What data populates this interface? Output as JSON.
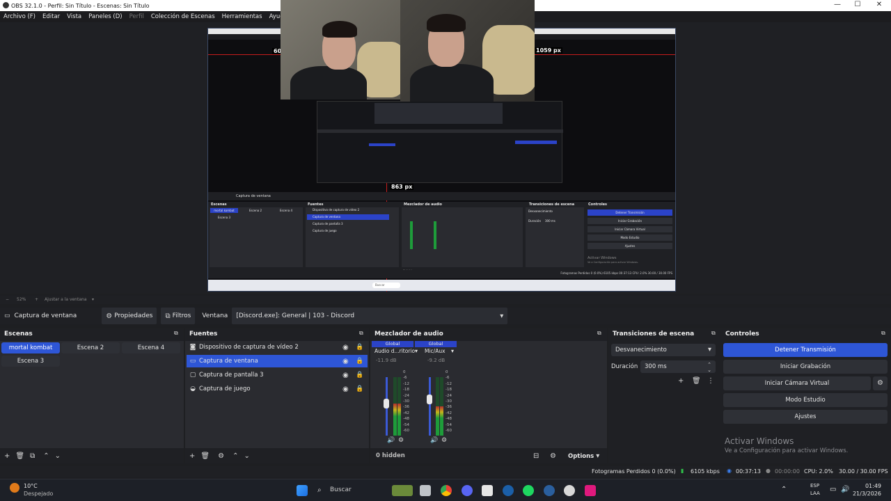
{
  "window": {
    "title": "OBS 32.1.0 - Perfil: Sin Título - Escenas: Sin Título",
    "minimize": "—",
    "maximize": "☐",
    "close": "✕"
  },
  "menu": [
    "Archivo (F)",
    "Editar",
    "Vista",
    "Paneles (D)",
    "Perfil",
    "Colección de Escenas",
    "Herramientas",
    "Ayuda (H)"
  ],
  "preview": {
    "label_right": "1059 px",
    "label_left": "605",
    "label_bottom": "863 px",
    "zoom": "52%",
    "fit": "Ajustar a la ventana",
    "nested": {
      "scenes_title": "Escenas",
      "sources_title": "Fuentes",
      "mixer_title": "Mezclador de audio",
      "transitions_title": "Transiciones de escena",
      "controls_title": "Controles",
      "source_item_1": "Dispositivo de captura de vídeo 2",
      "source_item_2": "Captura de ventana",
      "source_item_3": "Captura de pantalla 3",
      "source_item_4": "Captura de juego",
      "scene_1": "mortal kombat",
      "scene_2": "Escena 2",
      "scene_3": "Escena 4",
      "scene_4": "Escena 3",
      "transition": "Desvanecimiento",
      "duration_label": "Duración",
      "duration": "300 ms",
      "btn_stop": "Detener Transmisión",
      "btn_record": "Iniciar Grabación",
      "btn_vcam": "Iniciar Cámara Virtual",
      "btn_studio": "Modo Estudio",
      "btn_settings": "Ajustes",
      "activate": "Activar Windows",
      "activate_sub": "Ve a Configuración para activar Windows.",
      "search": "Buscar",
      "status": "Fotogramas Perdidos 0 (0.0%)  6105 kbps  00:37:13  CPU: 2.0%  30.00 / 30.00 FPS"
    }
  },
  "toolbar": {
    "source_name": "Captura de ventana",
    "properties": "Propiedades",
    "filters": "Filtros",
    "window_label": "Ventana",
    "window_value": "[Discord.exe]: General | 103 - Discord"
  },
  "scenes": {
    "title": "Escenas",
    "items": [
      "mortal kombat",
      "Escena 2",
      "Escena 4",
      "Escena 3"
    ]
  },
  "sources": {
    "title": "Fuentes",
    "items": [
      {
        "label": "Dispositivo de captura de vídeo 2",
        "icon": "camera-icon"
      },
      {
        "label": "Captura de ventana",
        "icon": "window-icon"
      },
      {
        "label": "Captura de pantalla 3",
        "icon": "monitor-icon"
      },
      {
        "label": "Captura de juego",
        "icon": "gamepad-icon"
      }
    ]
  },
  "mixer": {
    "title": "Mezclador de audio",
    "channels": [
      {
        "scope": "Global",
        "name": "Audio d...ritorio",
        "db": "-11.9 dB",
        "level": 0.55,
        "volume": 0.55
      },
      {
        "scope": "Global",
        "name": "Mic/Aux",
        "db": "-9.2 dB",
        "level": 0.5,
        "volume": 0.62
      }
    ],
    "scale": [
      "0",
      "-6",
      "-12",
      "-18",
      "-24",
      "-30",
      "-36",
      "-42",
      "-48",
      "-54",
      "-60"
    ],
    "hidden": "0 hidden",
    "options": "Options"
  },
  "transitions": {
    "title": "Transiciones de escena",
    "selected": "Desvanecimiento",
    "duration_label": "Duración",
    "duration_value": "300 ms"
  },
  "controls": {
    "title": "Controles",
    "buttons": [
      "Detener Transmisión",
      "Iniciar Grabación",
      "Iniciar Cámara Virtual",
      "Modo Estudio",
      "Ajustes"
    ]
  },
  "watermark": {
    "line1": "Activar Windows",
    "line2": "Ve a Configuración para activar Windows."
  },
  "status": {
    "dropped": "Fotogramas Perdidos 0 (0.0%)",
    "bitrate": "6105 kbps",
    "stream_time": "00:37:13",
    "rec_time": "00:00:00",
    "cpu": "CPU: 2.0%",
    "fps": "30.00 / 30.00 FPS"
  },
  "taskbar": {
    "weather_temp": "10°C",
    "weather_desc": "Despejado",
    "search": "Buscar",
    "lang1": "ESP",
    "lang2": "LAA",
    "time": "01:49",
    "date": "21/3/2026"
  },
  "colors": {
    "accent": "#2e56d6",
    "panel_bg": "#2a2b30",
    "app_bg": "#1f2024",
    "red_guide": "#c71c1c"
  }
}
